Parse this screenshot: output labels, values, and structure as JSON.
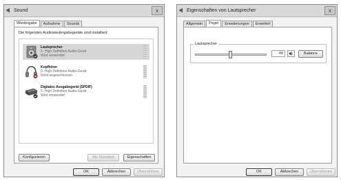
{
  "left_window": {
    "title": "Sound",
    "close_glyph": "x",
    "tabs": [
      {
        "label": "Wiedergabe",
        "active": true
      },
      {
        "label": "Aufnahme",
        "active": false
      },
      {
        "label": "Sounds",
        "active": false
      }
    ],
    "instruction": "Die folgenden Audiowiedergabegeräte sind installiert:",
    "devices": [
      {
        "name": "Lautsprecher",
        "line1": "5- High Definition Audio-Gerät",
        "line2": "Wird verwendet",
        "icon": "speaker-icon",
        "selected": true
      },
      {
        "name": "Kopfhörer",
        "line1": "5- High Definition Audio-Gerät",
        "line2": "Nicht angeschlossen",
        "icon": "headphones-icon",
        "selected": false
      },
      {
        "name": "Digitales Ausgabegerät (SPDIF)",
        "line1": "5- High Definition Audio-Gerät",
        "line2": "Wird verwendet",
        "icon": "digital-output-icon",
        "selected": false
      }
    ],
    "buttons": {
      "configure": "Konfigurieren",
      "set_default": "Als Standard",
      "properties": "Eigenschaften",
      "ok": "OK",
      "cancel": "Abbrechen",
      "apply": "Übernehmen"
    }
  },
  "right_window": {
    "title": "Eigenschaften von Lautsprecher",
    "close_glyph": "x",
    "tabs": [
      {
        "label": "Allgemein",
        "active": false
      },
      {
        "label": "Pegel",
        "active": true
      },
      {
        "label": "Erweiterungen",
        "active": false
      },
      {
        "label": "Erweitert",
        "active": false
      }
    ],
    "group_label": "Lautsprecher",
    "volume_value": "49",
    "volume_level": 0.49,
    "balance_button": "Balance",
    "buttons": {
      "ok": "OK",
      "cancel": "Abbrechen",
      "apply": "Übernehmen"
    }
  }
}
